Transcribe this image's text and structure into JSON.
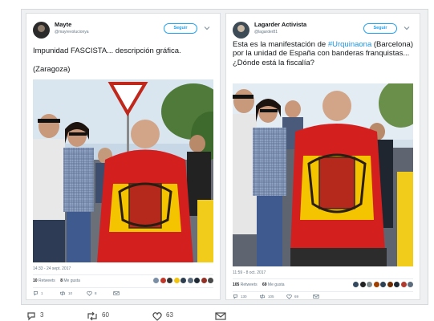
{
  "colors": {
    "accent": "#1da1f2",
    "hashtag": "#1b95e0",
    "muted": "#657786"
  },
  "left_tweet": {
    "author_name": "Mayte",
    "handle": "@mayrevolucionya",
    "follow_label": "Seguir",
    "text_line1": "Impunidad FASCISTA... descripción gráfica.",
    "text_line2": "(Zaragoza)",
    "timestamp": "14:33 - 24 sept. 2017",
    "retweets_count": "10",
    "retweets_label": "Retweets",
    "likes_count": "8",
    "likes_label": "Me gusta",
    "reply_count": "1",
    "retweet_action_count": "10",
    "like_action_count": "8"
  },
  "right_tweet": {
    "author_name": "Lagarder Activista",
    "handle": "@lagarder81",
    "follow_label": "Seguir",
    "text_before": "Esta es la manifestación de ",
    "hashtag": "#Urquinaona",
    "text_after": " (Barcelona) por la unidad de España con banderas franquistas... ¿Dónde está la fiscalía?",
    "timestamp": "11:59 - 8 oct. 2017",
    "retweets_count": "105",
    "retweets_label": "Retweets",
    "likes_count": "69",
    "likes_label": "Me gusta",
    "reply_count": "130",
    "retweet_action_count": "105",
    "like_action_count": "69"
  },
  "outer_actions": {
    "reply_count": "3",
    "retweet_count": "60",
    "like_count": "63"
  }
}
